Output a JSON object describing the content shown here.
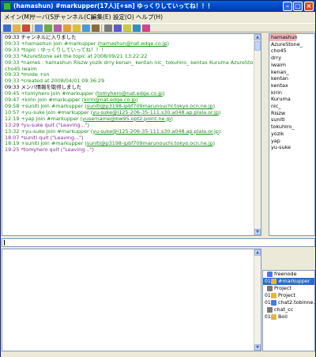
{
  "window": {
    "title": "(hamashun) #markupper(17人)[+sn] ゆっくりしていってね！！！"
  },
  "menu": [
    {
      "label": "メイン(M)"
    },
    {
      "label": "サーバ(S)"
    },
    {
      "label": "チャンネル(C)"
    },
    {
      "label": "編集(E)"
    },
    {
      "label": "設定(O)"
    },
    {
      "label": "ヘルプ(H)"
    }
  ],
  "toolbar": {
    "buttons": [
      {
        "icon": "server-icon",
        "color": "#3b6fc9"
      },
      {
        "icon": "folder-icon",
        "color": "#e0b64a"
      },
      {
        "icon": "disconnect-icon",
        "color": "#c84a3a"
      },
      {
        "icon": "channel-icon",
        "color": "#5a8de0"
      },
      {
        "icon": "join-icon",
        "color": "#6aaa4a"
      },
      {
        "icon": "part-icon",
        "color": "#b35ea8"
      },
      {
        "icon": "nick-icon",
        "color": "#e0a040"
      },
      {
        "icon": "topic-icon",
        "color": "#d8c23a"
      },
      {
        "icon": "dcc-icon",
        "color": "#4a9ad8"
      },
      {
        "icon": "log-icon",
        "color": "#8a6b3a"
      },
      {
        "icon": "settings-icon",
        "color": "#7a7a7a"
      },
      {
        "icon": "search-icon",
        "color": "#5a5ac8"
      },
      {
        "icon": "away-icon",
        "color": "#c8c84a"
      },
      {
        "icon": "help-icon",
        "color": "#3a8ac8"
      },
      {
        "icon": "about-icon",
        "color": "#c84a8a"
      }
    ]
  },
  "log": [
    {
      "time": "09:33",
      "text": "チャンネルに入りました",
      "style": "black"
    },
    {
      "time": "09:33",
      "text": "+hamashun join #markupper (",
      "user": "hamashun@nat.edge.co.jp",
      "tail": ")",
      "style": "green"
    },
    {
      "time": "09:33",
      "text": "*topic : ゆっくりしていってね！！！",
      "style": "green"
    },
    {
      "time": "09:33",
      "text": "*AzureStone set the topic at 2008/09/21 13:22:22",
      "style": "green"
    },
    {
      "time": "09:33",
      "text": "*names : hamashun Riszw yozik drry kenan_ kentan nic_ tokuhiro_ kentax Kuruma AzureStone_",
      "style": "green"
    },
    {
      "time": "",
      "text": "cho45 iwaim",
      "style": "green"
    },
    {
      "time": "09:33",
      "text": "*mode +sn",
      "style": "green"
    },
    {
      "time": "09:33",
      "text": "*created at 2008/04/01 09:36:29",
      "style": "green"
    },
    {
      "time": "09:33",
      "text": "メンバ情報を取得しました",
      "style": "black"
    },
    {
      "time": "09:45",
      "text": "+tomyhero join #markupper (",
      "user": "tomyhero@nat.edge.co.jp",
      "tail": ")",
      "style": "green"
    },
    {
      "time": "09:47",
      "text": "+kirin join #markupper (",
      "user": "kirin@nat.edge.co.jp",
      "tail": ")",
      "style": "green"
    },
    {
      "time": "09:58",
      "text": "+suniti join #markupper (",
      "user": "suniti@p3198-ipbf709marunouchi.tokyo.ocn.ne.jp",
      "tail": ")",
      "style": "green"
    },
    {
      "time": "10:57",
      "text": "+yu-suke join #markupper (",
      "user": "yu-suke@i125-206-35-111.s30.a048.ap.plala.or.jp",
      "tail": ")",
      "style": "green"
    },
    {
      "time": "12:19",
      "text": "+yap join #markupper (",
      "user": "yusername@bw95.opt2.point.ne.jp",
      "tail": ")",
      "style": "green"
    },
    {
      "time": "13:29",
      "text": "*yu-suke quit (\"Leaving...\")",
      "style": "purple"
    },
    {
      "time": "13:32",
      "text": "+yu-suke join #markupper (",
      "user": "yu-suke@i125-206-35-111.s30.a048.ap.plala.or.jp",
      "tail": ")",
      "style": "green"
    },
    {
      "time": "18:07",
      "text": "*suniti quit (\"Leaving...\")",
      "style": "purple"
    },
    {
      "time": "18:19",
      "text": "+suniti join #markupper (",
      "user": "suniti@p3198-ipbf709marunouchi.tokyo.ocn.ne.jp",
      "tail": ")",
      "style": "green"
    },
    {
      "time": "19:25",
      "text": "*tomyhero quit (\"Leaving...\")",
      "style": "purple"
    }
  ],
  "nicks": [
    {
      "name": "hamashun",
      "op": true
    },
    {
      "name": "AzureStone_"
    },
    {
      "name": "cho45"
    },
    {
      "name": "drry"
    },
    {
      "name": "iwaim"
    },
    {
      "name": "kenan_"
    },
    {
      "name": "kentan"
    },
    {
      "name": "kentax"
    },
    {
      "name": "kirin"
    },
    {
      "name": "Kuruma"
    },
    {
      "name": "nic_"
    },
    {
      "name": "Riszw"
    },
    {
      "name": "suniti"
    },
    {
      "name": "tokuhiro_"
    },
    {
      "name": "yozik"
    },
    {
      "name": "yap"
    },
    {
      "name": "yu-suke"
    }
  ],
  "tree": [
    {
      "label": "freenode",
      "num": "",
      "color": "#4a7ad8",
      "selected": false,
      "indent": 1
    },
    {
      "label": "#markupper",
      "num": "01",
      "color": "#e0b64a",
      "selected": true,
      "indent": 0
    },
    {
      "label": "Project",
      "num": "",
      "color": "#7a7a7a",
      "selected": false,
      "indent": 1
    },
    {
      "label": "Project",
      "num": "01",
      "color": "#e0b64a",
      "selected": false,
      "indent": 0
    },
    {
      "label": "chat2.tobinne.n",
      "num": "01",
      "color": "#4a7ad8",
      "selected": false,
      "indent": 0
    },
    {
      "label": "chat_cc",
      "num": "",
      "color": "#7a7a7a",
      "selected": false,
      "indent": 1
    },
    {
      "label": "Boil",
      "num": "01",
      "color": "#e0b64a",
      "selected": false,
      "indent": 0
    }
  ]
}
